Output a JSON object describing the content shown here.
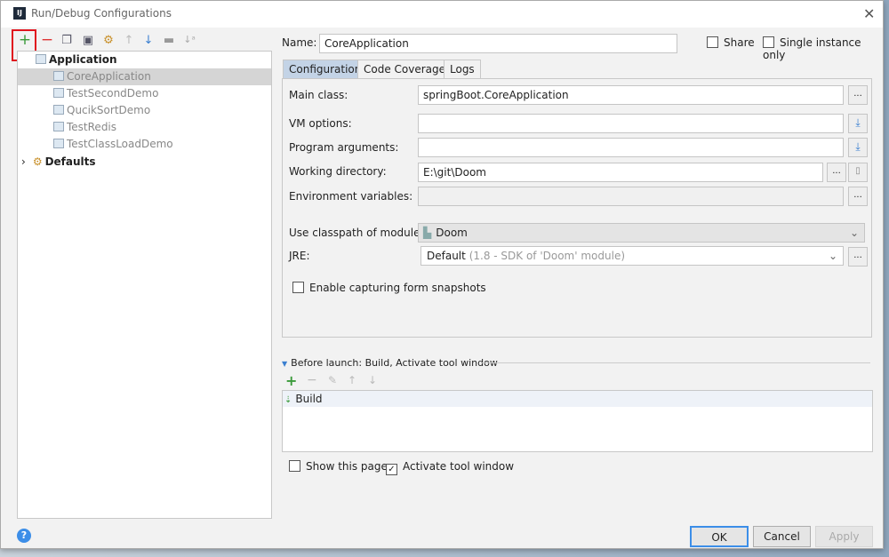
{
  "window": {
    "title": "Run/Debug Configurations",
    "logo": "IJ"
  },
  "toolbar": {
    "icons": [
      "plus-icon",
      "minus-icon",
      "copy-icon",
      "save-icon",
      "wrench-icon",
      "arrow-up-icon",
      "arrow-down-icon",
      "folder-icon",
      "sort-icon"
    ]
  },
  "tree": {
    "root": "Application",
    "items": [
      "CoreApplication",
      "TestSecondDemo",
      "QucikSortDemo",
      "TestRedis",
      "TestClassLoadDemo"
    ],
    "defaults": "Defaults"
  },
  "name": {
    "label": "Name:",
    "value": "CoreApplication"
  },
  "share": "Share",
  "single_instance": "Single instance only",
  "tabs": [
    "Configuration",
    "Code Coverage",
    "Logs"
  ],
  "form": {
    "main_class_label": "Main class:",
    "main_class": "springBoot.CoreApplication",
    "vm_label": "VM options:",
    "vm": "",
    "args_label": "Program arguments:",
    "args": "",
    "wd_label": "Working directory:",
    "wd": "E:\\git\\Doom",
    "env_label": "Environment variables:",
    "env": "",
    "module_label": "Use classpath of module:",
    "module": "Doom",
    "jre_label": "JRE:",
    "jre": "Default",
    "jre_hint": "(1.8 - SDK of 'Doom' module)",
    "snapshots": "Enable capturing form snapshots",
    "dots": "..."
  },
  "before_launch": {
    "title": "Before launch: Build, Activate tool window",
    "items": [
      "Build"
    ],
    "show_page": "Show this page",
    "activate": "Activate tool window",
    "activate_checked": true,
    "show_checked": false
  },
  "buttons": {
    "ok": "OK",
    "cancel": "Cancel",
    "apply": "Apply",
    "help": "?"
  },
  "colors": {
    "accent": "#3c8ee8",
    "selected_tab": "#c3d3e6",
    "highlight": "#e0141e"
  }
}
